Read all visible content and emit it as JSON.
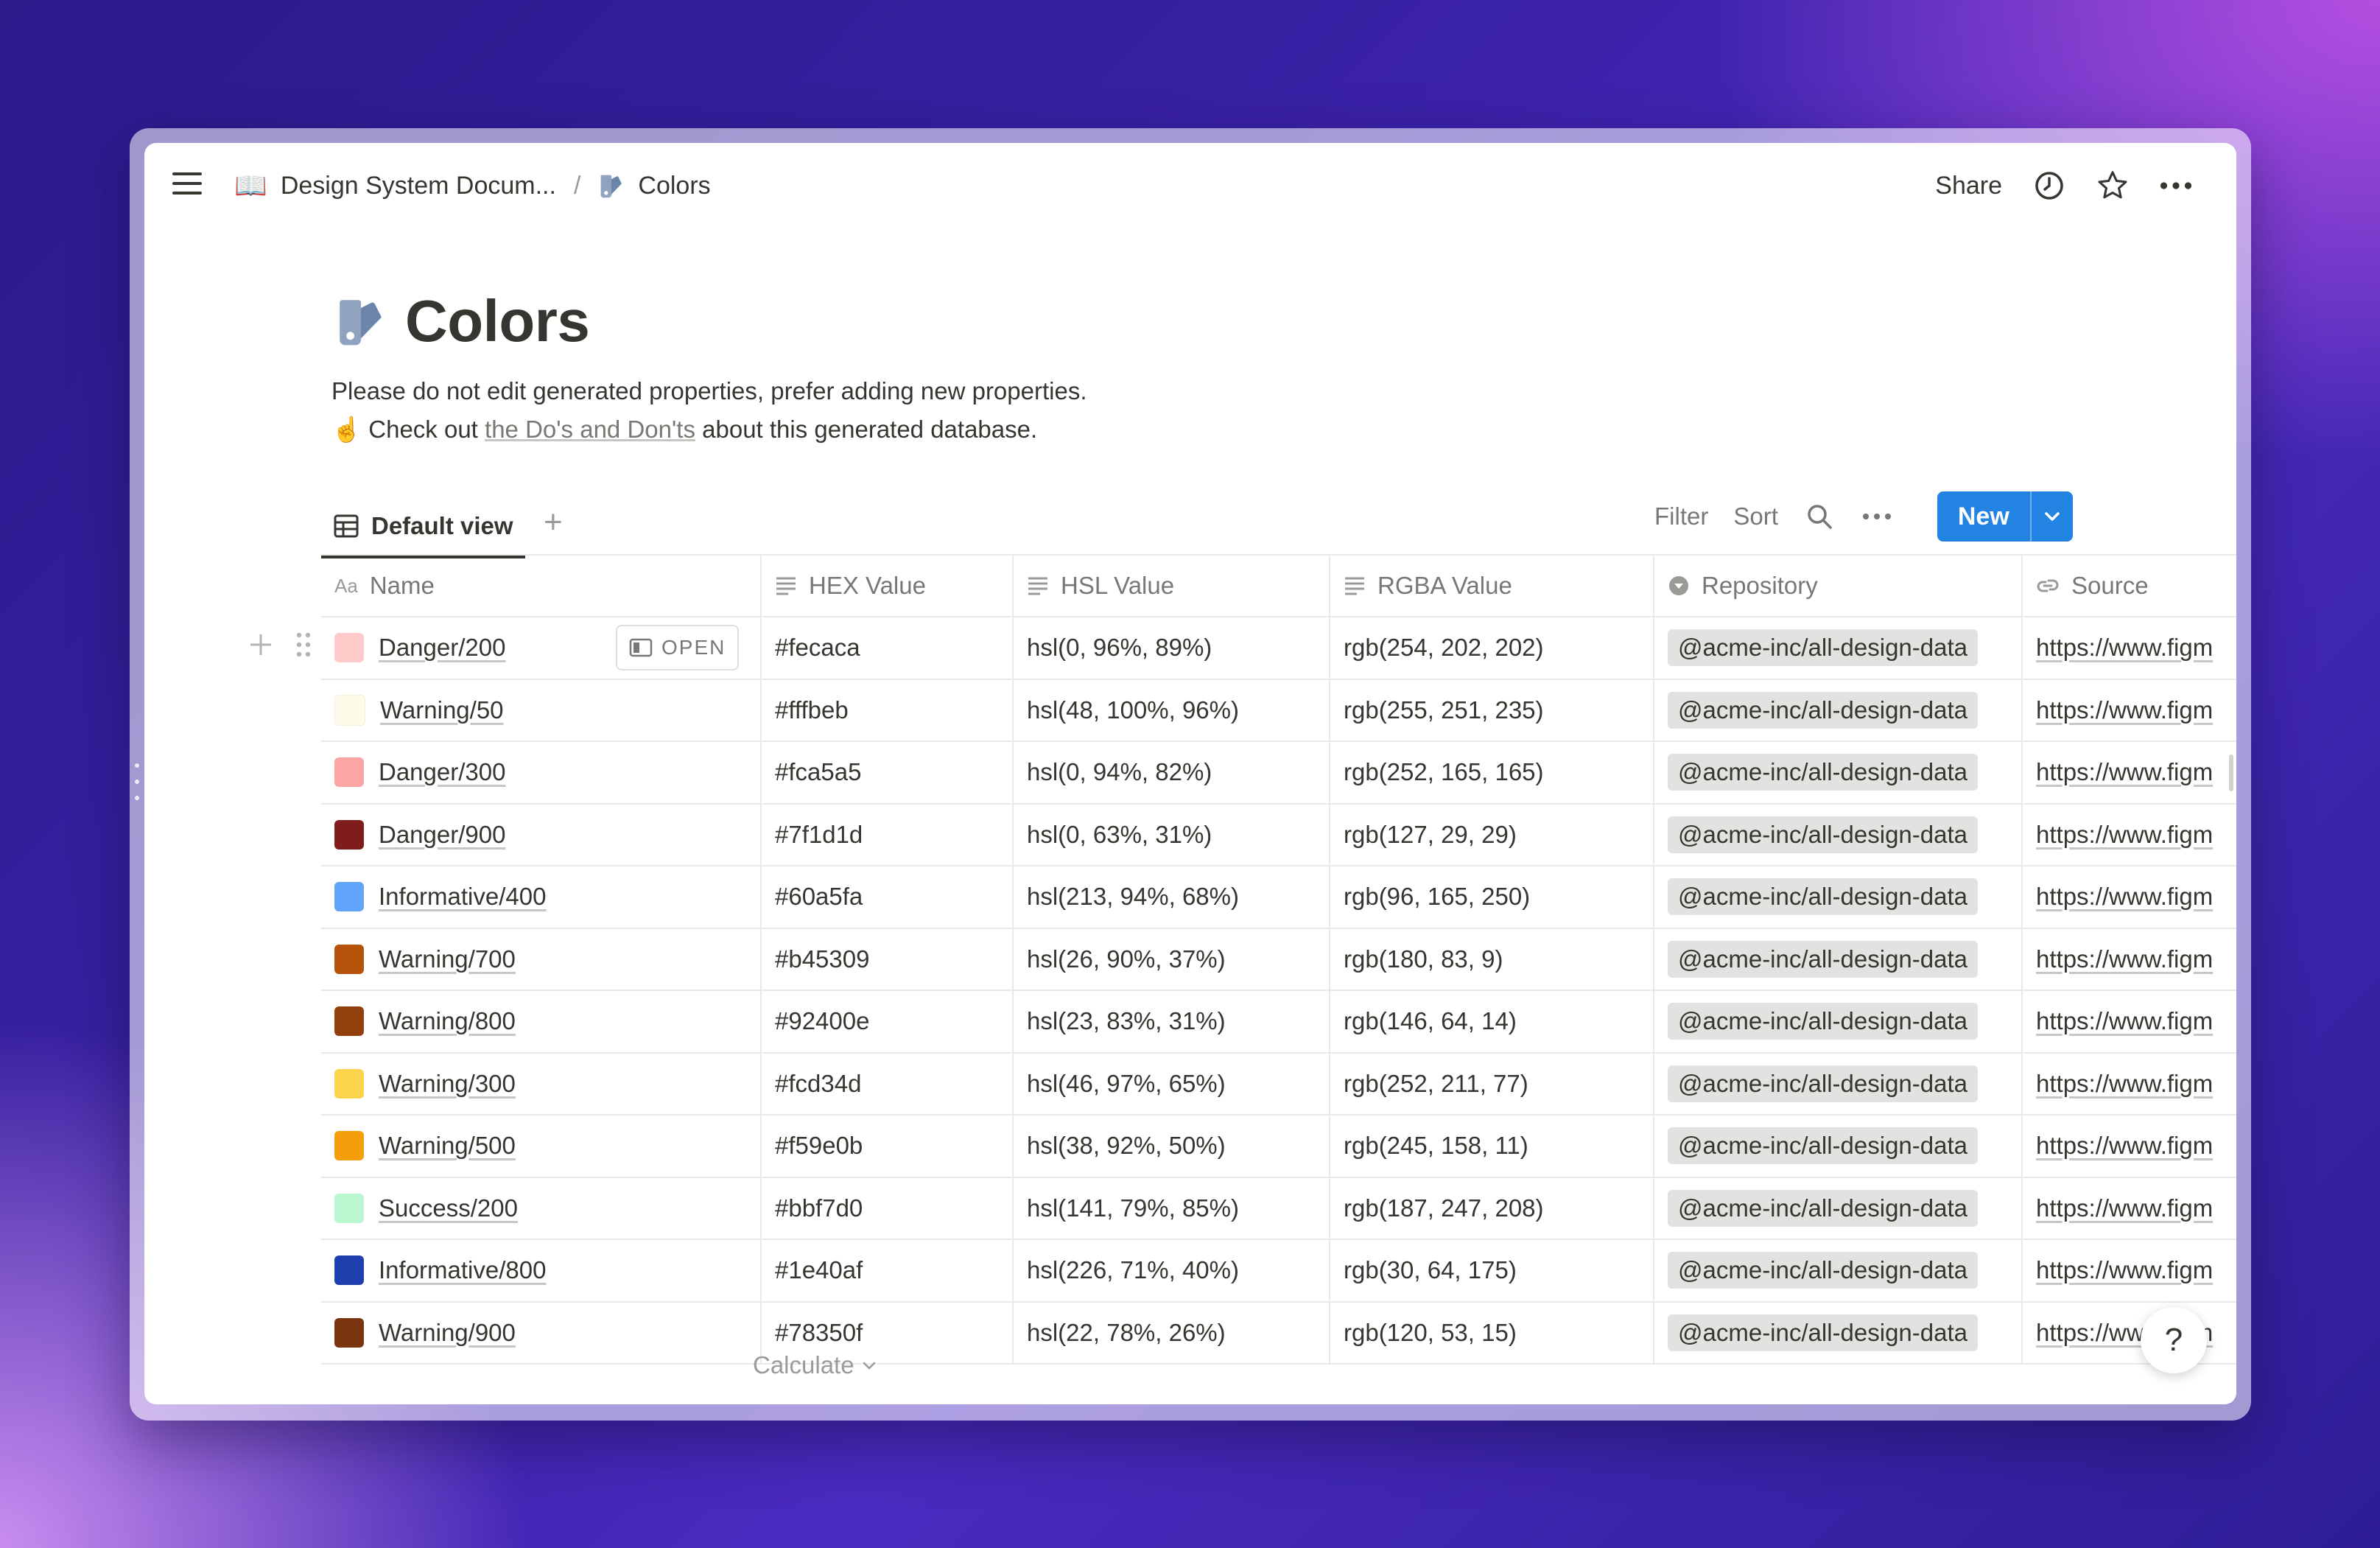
{
  "breadcrumb": {
    "parent_emoji": "📖",
    "parent": "Design System Docum...",
    "separator": "/",
    "current": "Colors"
  },
  "top_actions": {
    "share": "Share"
  },
  "page": {
    "title": "Colors",
    "description_line1": "Please do not edit generated properties, prefer adding new properties.",
    "description_line2_emoji": "☝️",
    "description_line2_prefix": "Check out",
    "description_line2_link": "the Do's and Don'ts",
    "description_line2_suffix": "about this generated database."
  },
  "view": {
    "tab_label": "Default view",
    "filter": "Filter",
    "sort": "Sort",
    "new_label": "New"
  },
  "table": {
    "columns": [
      "Name",
      "HEX Value",
      "HSL Value",
      "RGBA Value",
      "Repository",
      "Source"
    ],
    "open_label": "OPEN",
    "rows": [
      {
        "name": "Danger/200",
        "hex": "#fecaca",
        "hsl": "hsl(0, 96%, 89%)",
        "rgba": "rgb(254, 202, 202)",
        "repo": "@acme-inc/all-design-data",
        "source": "https://www.figm",
        "swatch": "#fecaca"
      },
      {
        "name": "Warning/50",
        "hex": "#fffbeb",
        "hsl": "hsl(48, 100%, 96%)",
        "rgba": "rgb(255, 251, 235)",
        "repo": "@acme-inc/all-design-data",
        "source": "https://www.figm",
        "swatch": "#fffbeb"
      },
      {
        "name": "Danger/300",
        "hex": "#fca5a5",
        "hsl": "hsl(0, 94%, 82%)",
        "rgba": "rgb(252, 165, 165)",
        "repo": "@acme-inc/all-design-data",
        "source": "https://www.figm",
        "swatch": "#fca5a5"
      },
      {
        "name": "Danger/900",
        "hex": "#7f1d1d",
        "hsl": "hsl(0, 63%, 31%)",
        "rgba": "rgb(127, 29, 29)",
        "repo": "@acme-inc/all-design-data",
        "source": "https://www.figm",
        "swatch": "#7f1d1d"
      },
      {
        "name": "Informative/400",
        "hex": "#60a5fa",
        "hsl": "hsl(213, 94%, 68%)",
        "rgba": "rgb(96, 165, 250)",
        "repo": "@acme-inc/all-design-data",
        "source": "https://www.figm",
        "swatch": "#60a5fa"
      },
      {
        "name": "Warning/700",
        "hex": "#b45309",
        "hsl": "hsl(26, 90%, 37%)",
        "rgba": "rgb(180, 83, 9)",
        "repo": "@acme-inc/all-design-data",
        "source": "https://www.figm",
        "swatch": "#b45309"
      },
      {
        "name": "Warning/800",
        "hex": "#92400e",
        "hsl": "hsl(23, 83%, 31%)",
        "rgba": "rgb(146, 64, 14)",
        "repo": "@acme-inc/all-design-data",
        "source": "https://www.figm",
        "swatch": "#92400e"
      },
      {
        "name": "Warning/300",
        "hex": "#fcd34d",
        "hsl": "hsl(46, 97%, 65%)",
        "rgba": "rgb(252, 211, 77)",
        "repo": "@acme-inc/all-design-data",
        "source": "https://www.figm",
        "swatch": "#fcd34d"
      },
      {
        "name": "Warning/500",
        "hex": "#f59e0b",
        "hsl": "hsl(38, 92%, 50%)",
        "rgba": "rgb(245, 158, 11)",
        "repo": "@acme-inc/all-design-data",
        "source": "https://www.figm",
        "swatch": "#f59e0b"
      },
      {
        "name": "Success/200",
        "hex": "#bbf7d0",
        "hsl": "hsl(141, 79%, 85%)",
        "rgba": "rgb(187, 247, 208)",
        "repo": "@acme-inc/all-design-data",
        "source": "https://www.figm",
        "swatch": "#bbf7d0"
      },
      {
        "name": "Informative/800",
        "hex": "#1e40af",
        "hsl": "hsl(226, 71%, 40%)",
        "rgba": "rgb(30, 64, 175)",
        "repo": "@acme-inc/all-design-data",
        "source": "https://www.figm",
        "swatch": "#1e40af"
      },
      {
        "name": "Warning/900",
        "hex": "#78350f",
        "hsl": "hsl(22, 78%, 26%)",
        "rgba": "rgb(120, 53, 15)",
        "repo": "@acme-inc/all-design-data",
        "source": "https://www.figm",
        "swatch": "#78350f"
      }
    ]
  },
  "footer": {
    "calculate": "Calculate",
    "help": "?"
  },
  "colors": {
    "accent": "#2383e2",
    "tag_bg": "#e3e2e0",
    "text": "#37352f"
  }
}
